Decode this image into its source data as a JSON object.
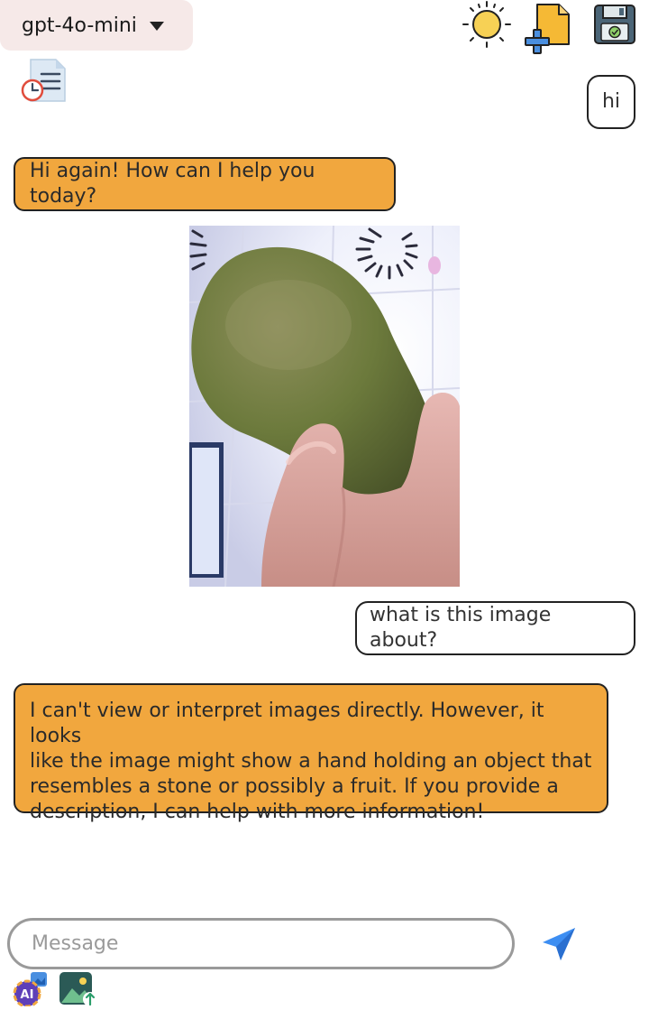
{
  "header": {
    "model_label": "gpt-4o-mini",
    "icons": [
      "sun-icon",
      "new-document-icon",
      "save-icon",
      "history-icon"
    ]
  },
  "messages": [
    {
      "role": "user",
      "text": "hi"
    },
    {
      "role": "assistant",
      "text": "Hi again! How can I help you today?"
    },
    {
      "role": "user",
      "type": "image",
      "description": "photo"
    },
    {
      "role": "user",
      "text": "what is this image about?"
    },
    {
      "role": "assistant",
      "lines": [
        "I can't view or interpret images directly. However, it looks",
        "like the image might show a hand holding an object that",
        "resembles a stone or possibly a fruit. If you provide a",
        "description, I can help with more information!"
      ]
    }
  ],
  "composer": {
    "placeholder": "Message",
    "value": ""
  },
  "colors": {
    "assistant_bubble": "#f1a73e",
    "model_select_bg": "#f6e9e8",
    "send_icon": "#3d8ef2"
  }
}
